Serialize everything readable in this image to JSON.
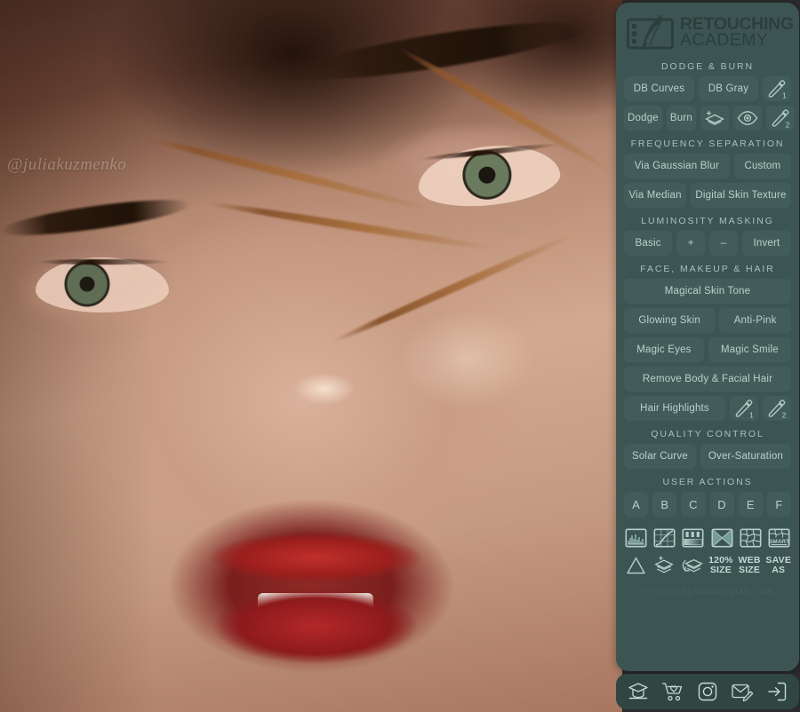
{
  "colors": {
    "panel_bg": "#3c5552",
    "button_bg": "#425d59",
    "text": "#b9d0cc",
    "section_title": "#a8c0bc",
    "logo": "#2c3f3d",
    "bottom_nav_bg": "#2f4643",
    "watermark": "#47605c"
  },
  "photo": {
    "watermark": "@juliakuzmenko"
  },
  "panel": {
    "logo": {
      "line1": "RETOUCHING",
      "line2": "ACADEMY",
      "icon": "tablet-feather-logo-icon"
    },
    "watermark": "retouchingacademylab.com",
    "sections": [
      {
        "title": "DODGE & BURN",
        "rows": [
          [
            {
              "label": "DB Curves",
              "type": "text"
            },
            {
              "label": "DB Gray",
              "type": "text"
            },
            {
              "label": "",
              "type": "icon",
              "icon": "brush-1-icon"
            }
          ],
          [
            {
              "label": "Dodge",
              "type": "text"
            },
            {
              "label": "Burn",
              "type": "text"
            },
            {
              "label": "",
              "type": "icon",
              "icon": "add-layer-icon"
            },
            {
              "label": "",
              "type": "icon",
              "icon": "eye-icon"
            },
            {
              "label": "",
              "type": "icon",
              "icon": "brush-2-icon"
            }
          ]
        ]
      },
      {
        "title": "FREQUENCY SEPARATION",
        "rows": [
          [
            {
              "label": "Via Gaussian Blur",
              "type": "text"
            },
            {
              "label": "Custom",
              "type": "text"
            }
          ],
          [
            {
              "label": "Via Median",
              "type": "text"
            },
            {
              "label": "Digital Skin Texture",
              "type": "text"
            }
          ]
        ]
      },
      {
        "title": "LUMINOSITY MASKING",
        "rows": [
          [
            {
              "label": "Basic",
              "type": "text"
            },
            {
              "label": "+",
              "type": "text"
            },
            {
              "label": "–",
              "type": "text"
            },
            {
              "label": "Invert",
              "type": "text"
            }
          ]
        ]
      },
      {
        "title": "FACE, MAKEUP & HAIR",
        "rows": [
          [
            {
              "label": "Magical Skin Tone",
              "type": "text"
            }
          ],
          [
            {
              "label": "Glowing Skin",
              "type": "text"
            },
            {
              "label": "Anti-Pink",
              "type": "text"
            }
          ],
          [
            {
              "label": "Magic Eyes",
              "type": "text"
            },
            {
              "label": "Magic Smile",
              "type": "text"
            }
          ],
          [
            {
              "label": "Remove Body & Facial Hair",
              "type": "text"
            }
          ],
          [
            {
              "label": "Hair Highlights",
              "type": "text"
            },
            {
              "label": "",
              "type": "icon",
              "icon": "brush-1-icon"
            },
            {
              "label": "",
              "type": "icon",
              "icon": "brush-2-icon"
            }
          ]
        ]
      },
      {
        "title": "QUALITY CONTROL",
        "rows": [
          [
            {
              "label": "Solar Curve",
              "type": "text"
            },
            {
              "label": "Over-Saturation",
              "type": "text"
            }
          ]
        ]
      },
      {
        "title": "USER ACTIONS",
        "rows": [
          [
            {
              "label": "A",
              "type": "letter"
            },
            {
              "label": "B",
              "type": "letter"
            },
            {
              "label": "C",
              "type": "letter"
            },
            {
              "label": "D",
              "type": "letter"
            },
            {
              "label": "E",
              "type": "letter"
            },
            {
              "label": "F",
              "type": "letter"
            }
          ]
        ]
      }
    ],
    "icon_rows": [
      [
        {
          "icon": "histogram-icon",
          "label": ""
        },
        {
          "icon": "curves-icon",
          "label": ""
        },
        {
          "icon": "levels-icon",
          "label": ""
        },
        {
          "icon": "gradient-x-icon",
          "label": ""
        },
        {
          "icon": "mesh-warp-icon",
          "label": ""
        },
        {
          "icon": "smart-sharpen-icon",
          "label": ""
        }
      ],
      [
        {
          "icon": "triangle-icon",
          "label": ""
        },
        {
          "icon": "stamp-visible-layer-icon",
          "label": ""
        },
        {
          "icon": "merge-layers-icon",
          "label": ""
        },
        {
          "icon": "",
          "label": "120% SIZE"
        },
        {
          "icon": "",
          "label": "WEB SIZE"
        },
        {
          "icon": "",
          "label": "SAVE AS"
        }
      ]
    ],
    "bottom_nav": [
      {
        "icon": "academy-icon"
      },
      {
        "icon": "cart-heart-icon"
      },
      {
        "icon": "instagram-icon"
      },
      {
        "icon": "email-edit-icon"
      },
      {
        "icon": "logout-icon"
      }
    ]
  }
}
